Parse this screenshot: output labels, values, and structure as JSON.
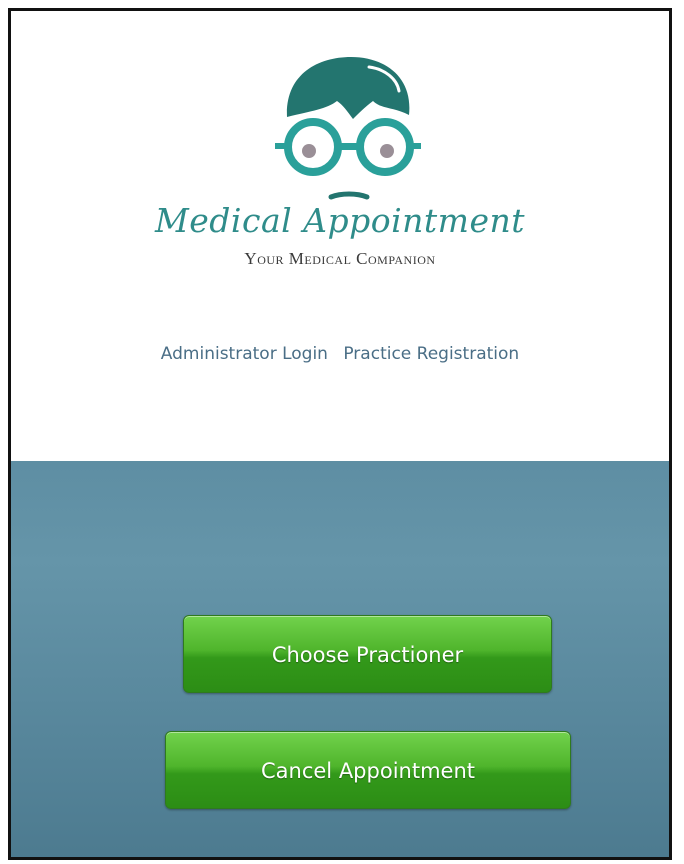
{
  "logo": {
    "title": "Medical Appointment",
    "subtitle": "Your Medical Companion",
    "icon": "doctor-face-with-glasses-icon",
    "colors": {
      "teal": "#2f8c8a",
      "hair": "#23756f"
    }
  },
  "nav": {
    "admin_login": "Administrator Login",
    "practice_registration": "Practice Registration"
  },
  "actions": {
    "choose_practitioner": "Choose Practioner",
    "cancel_appointment": "Cancel Appointment"
  },
  "colors": {
    "button_green": "#4fb52c",
    "panel_blue": "#5e8ea3",
    "link_blue": "#4a6e86"
  }
}
